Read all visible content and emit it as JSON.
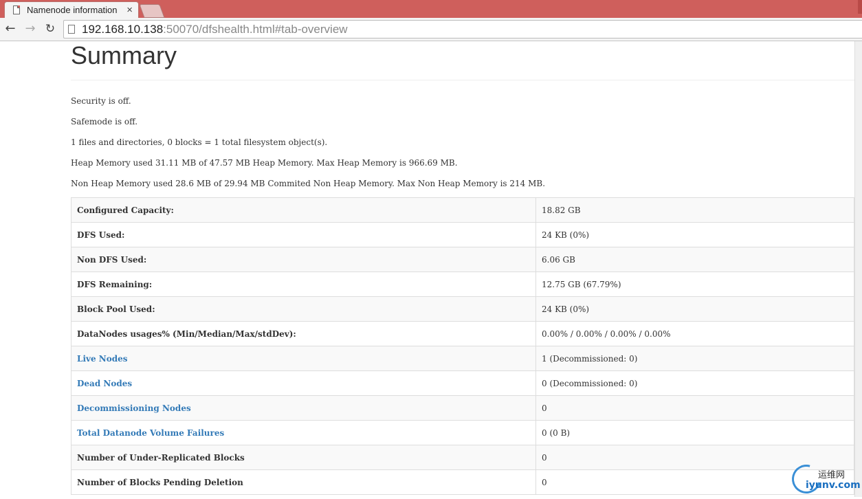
{
  "browser": {
    "tab_title": "Namenode information",
    "tab_close": "×",
    "url_host": "192.168.10.138",
    "url_rest": ":50070/dfshealth.html#tab-overview",
    "back_icon": "arrow-left-icon",
    "forward_icon": "arrow-right-icon",
    "reload_icon": "reload-icon",
    "back_glyph": "←",
    "forward_glyph": "→",
    "reload_glyph": "↻",
    "accent_color": "#cf5f5c"
  },
  "summary": {
    "title": "Summary",
    "lines": [
      "Security is off.",
      "Safemode is off.",
      "1 files and directories, 0 blocks = 1 total filesystem object(s).",
      "Heap Memory used 31.11 MB of 47.57 MB Heap Memory. Max Heap Memory is 966.69 MB.",
      "Non Heap Memory used 28.6 MB of 29.94 MB Commited Non Heap Memory. Max Non Heap Memory is 214 MB."
    ],
    "rows": [
      {
        "key": "Configured Capacity:",
        "value": "18.82 GB"
      },
      {
        "key": "DFS Used:",
        "value": "24 KB (0%)"
      },
      {
        "key": "Non DFS Used:",
        "value": "6.06 GB"
      },
      {
        "key": "DFS Remaining:",
        "value": "12.75 GB (67.79%)"
      },
      {
        "key": "Block Pool Used:",
        "value": "24 KB (0%)"
      },
      {
        "key": "DataNodes usages% (Min/Median/Max/stdDev):",
        "value": "0.00% / 0.00% / 0.00% / 0.00%"
      },
      {
        "key": "Live Nodes",
        "value": "1 (Decommissioned: 0)"
      },
      {
        "key": "Dead Nodes",
        "value": "0 (Decommissioned: 0)"
      },
      {
        "key": "Decommissioning Nodes",
        "value": "0"
      },
      {
        "key": "Total Datanode Volume Failures",
        "value": "0 (0 B)"
      },
      {
        "key": "Number of Under-Replicated Blocks",
        "value": "0"
      },
      {
        "key": "Number of Blocks Pending Deletion",
        "value": "0"
      }
    ],
    "link_color": "#337ab7"
  },
  "watermark": {
    "cn": "运维网",
    "en": "iyunv.com"
  }
}
